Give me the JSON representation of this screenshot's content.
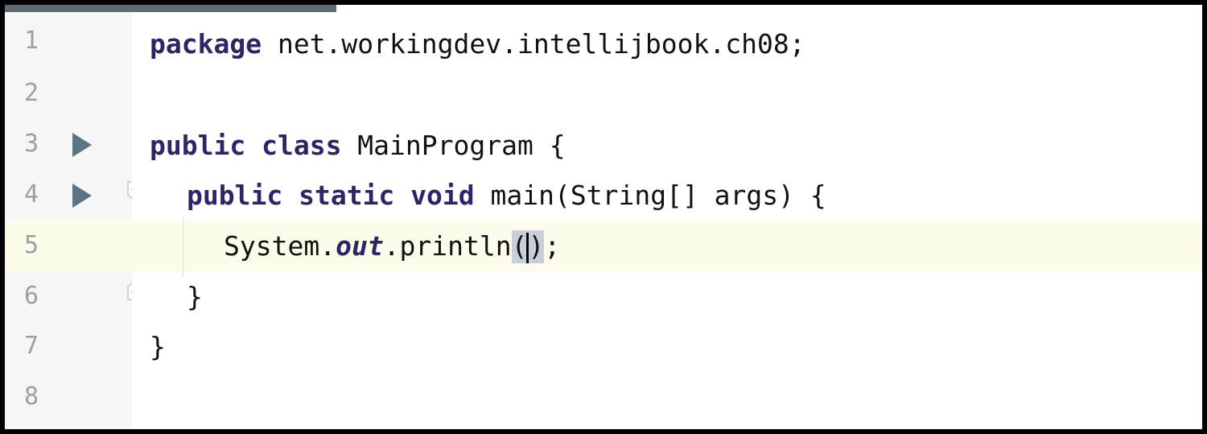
{
  "editor": {
    "line_numbers": [
      "1",
      "2",
      "3",
      "4",
      "5",
      "6",
      "7",
      "8"
    ],
    "current_line": "5",
    "run_gutter_lines": [
      "3",
      "4"
    ],
    "lines": {
      "l1": {
        "kw": "package",
        "rest": " net.workingdev.intellijbook.ch08;"
      },
      "l3": {
        "kw1": "public",
        "kw2": "class",
        "rest": " MainProgram {"
      },
      "l4": {
        "kw1": "public",
        "kw2": "static",
        "kw3": "void",
        "rest": " main(String[] args) {"
      },
      "l5": {
        "pre": "System.",
        "field": "out",
        "mid": ".println",
        "paren_open": "(",
        "paren_close": ")",
        "post": ";"
      },
      "l6": {
        "text": "}"
      },
      "l7": {
        "text": "}"
      }
    }
  },
  "colors": {
    "keyword": "#2d2566",
    "current_line_bg": "#fdfbe9",
    "run_icon": "#5c7585",
    "paren_match_bg": "#c7cfd8"
  },
  "icons": {
    "run": "run-triangle-icon",
    "fold": "fold-marker-icon"
  }
}
